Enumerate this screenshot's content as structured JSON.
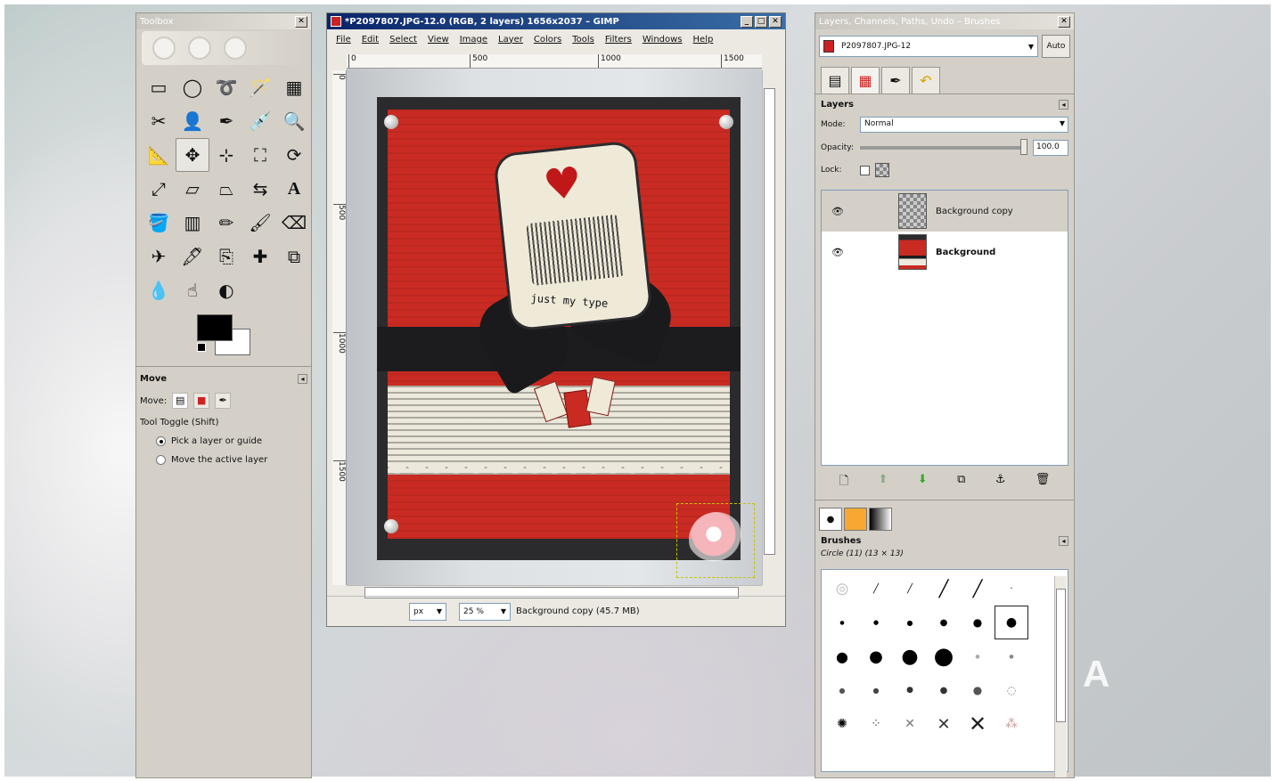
{
  "toolbox": {
    "title": "Toolbox",
    "tool_options": {
      "title": "Move",
      "move_label": "Move:",
      "tool_toggle": "Tool Toggle  (Shift)",
      "option_pick": "Pick a layer or guide",
      "option_active": "Move the active layer"
    }
  },
  "image_window": {
    "title": "*P2097807.JPG-12.0 (RGB, 2 layers) 1656x2037 – GIMP",
    "menu": [
      "File",
      "Edit",
      "Select",
      "View",
      "Image",
      "Layer",
      "Colors",
      "Tools",
      "Filters",
      "Windows",
      "Help"
    ],
    "ruler_h": [
      "0",
      "500",
      "1000",
      "1500"
    ],
    "ruler_v": [
      "0",
      "500",
      "1000",
      "1500"
    ],
    "stamp_text": "just my type",
    "status": {
      "unit": "px",
      "zoom": "25 %",
      "layer_info": "Background copy (45.7 MB)"
    }
  },
  "dock": {
    "title": "Layers, Channels, Paths, Undo – Brushes",
    "image_select": "P2097807.JPG-12",
    "auto_label": "Auto",
    "layers": {
      "title": "Layers",
      "mode_label": "Mode:",
      "mode_value": "Normal",
      "opacity_label": "Opacity:",
      "opacity_value": "100.0",
      "lock_label": "Lock:",
      "items": [
        {
          "name": "Background copy",
          "selected": true
        },
        {
          "name": "Background",
          "selected": false
        }
      ]
    },
    "brushes": {
      "title": "Brushes",
      "current": "Circle (11) (13 × 13)"
    }
  },
  "desktop": {
    "watermark": "A"
  }
}
